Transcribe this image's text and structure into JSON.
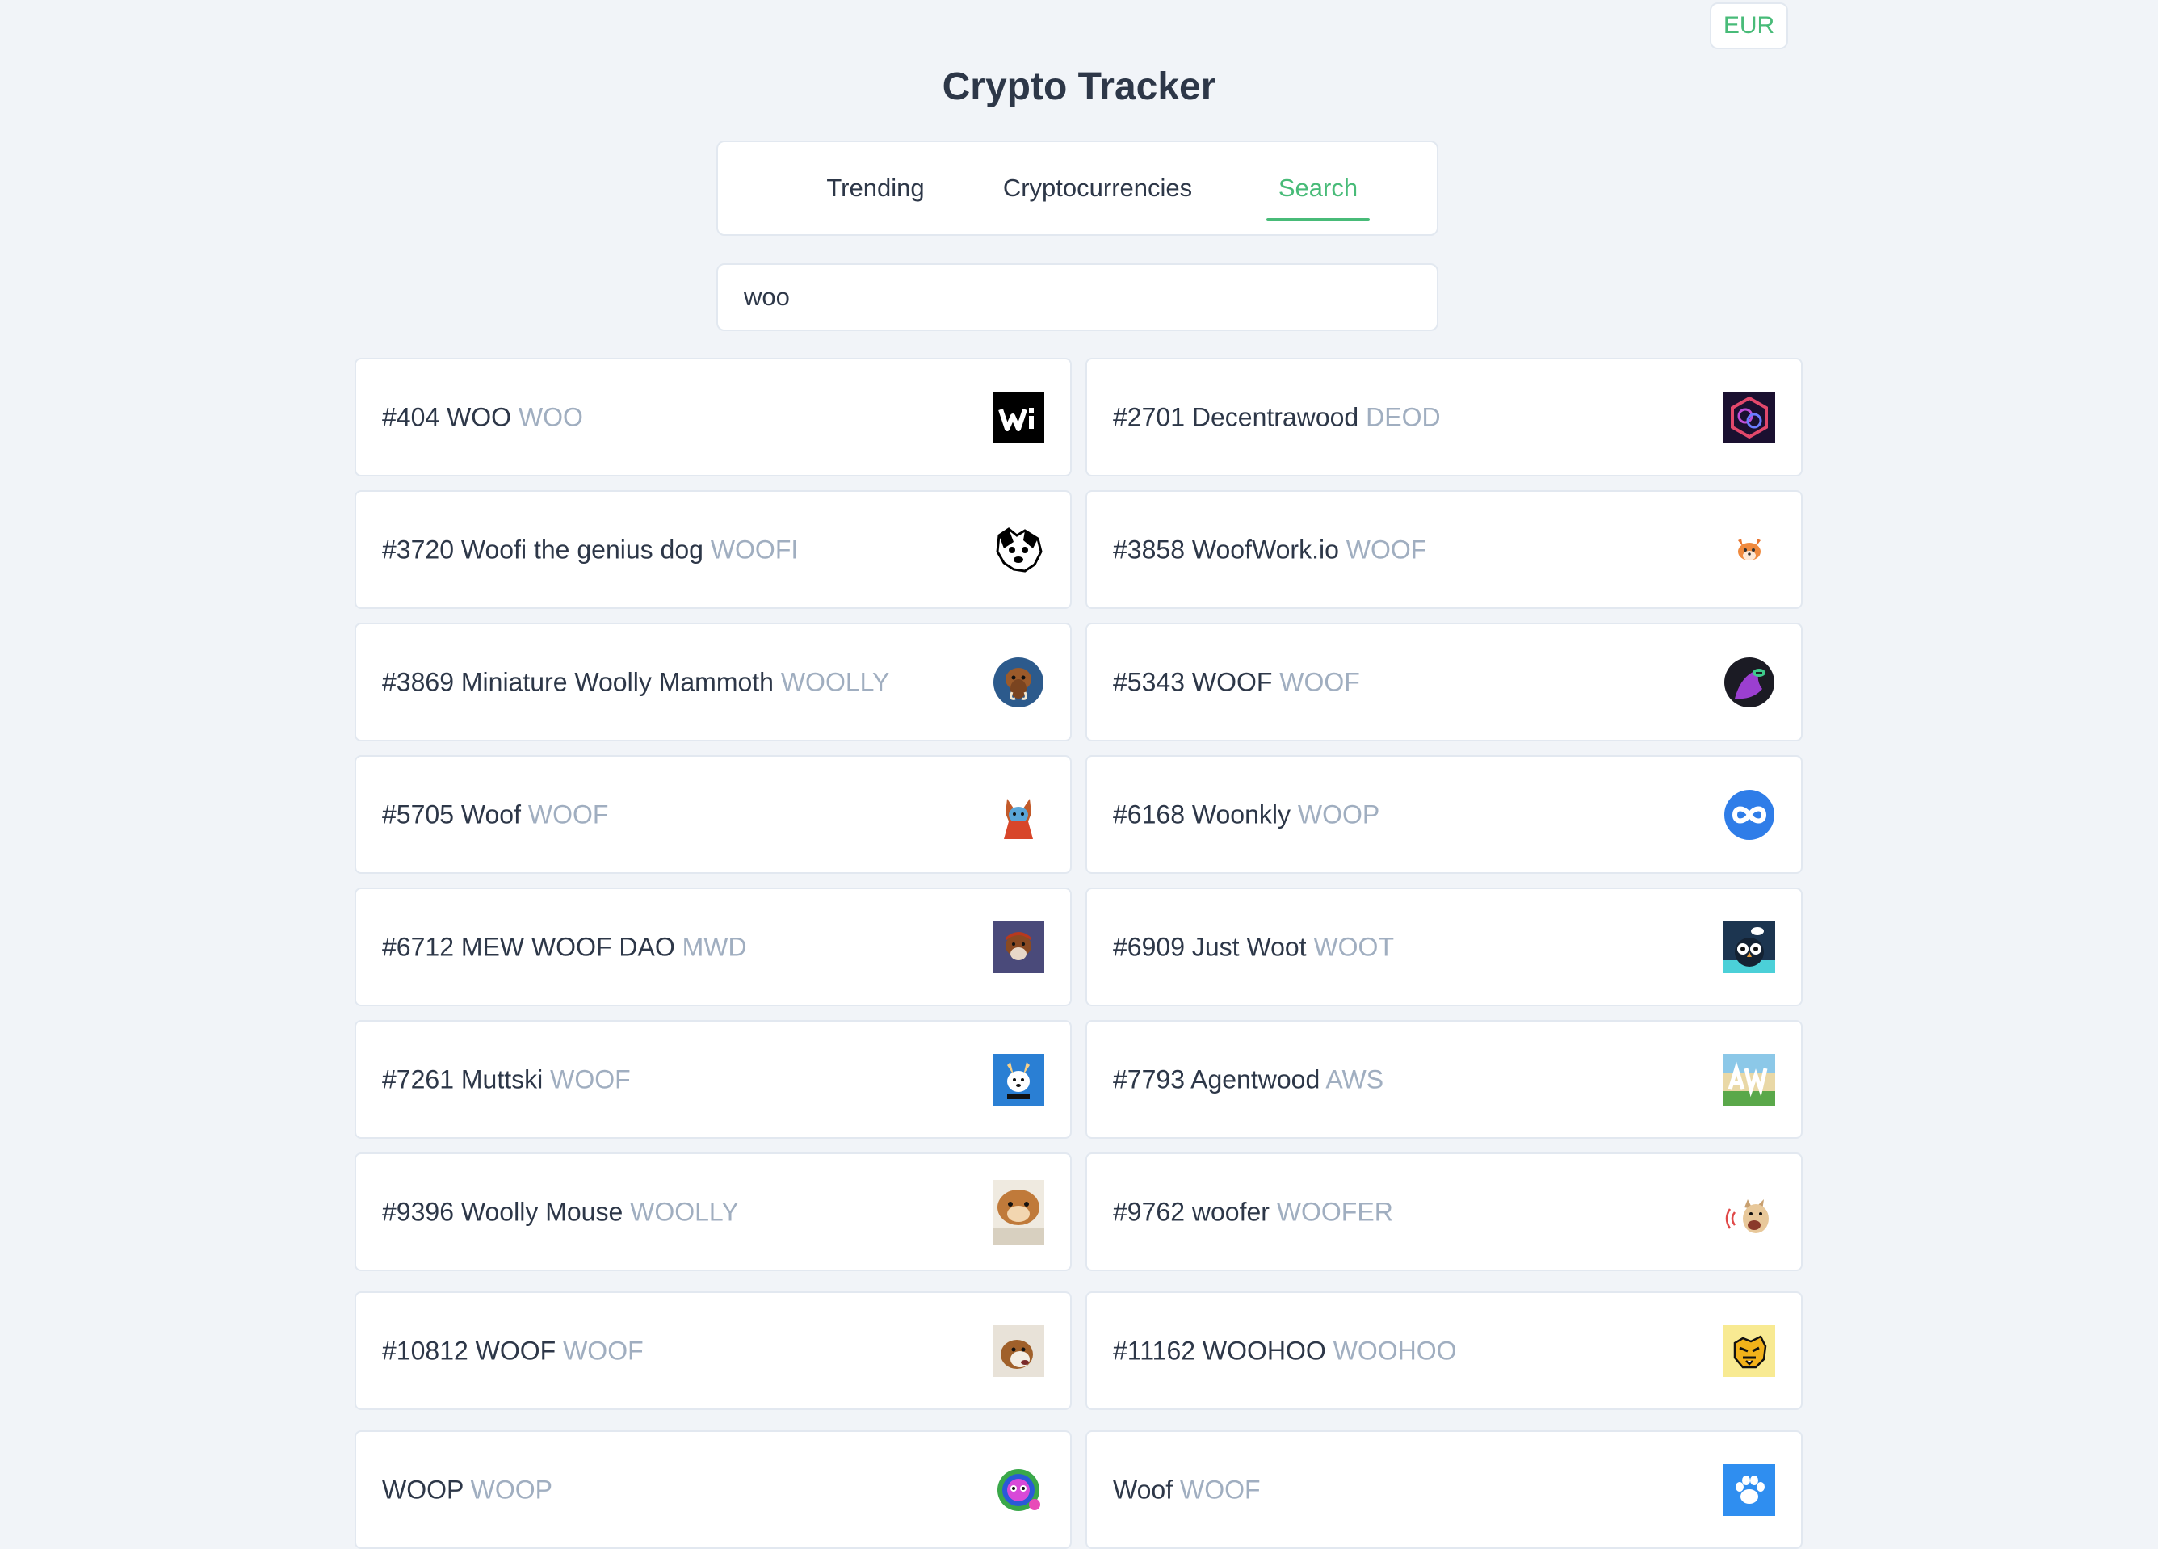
{
  "header": {
    "currency": "EUR",
    "title": "Crypto Tracker"
  },
  "tabs": [
    {
      "label": "Trending",
      "active": false
    },
    {
      "label": "Cryptocurrencies",
      "active": false
    },
    {
      "label": "Search",
      "active": true
    }
  ],
  "search": {
    "value": "woo",
    "placeholder": ""
  },
  "colors": {
    "accent": "#48bb78",
    "background": "#f1f4f8",
    "text": "#2d3748",
    "muted": "#a0aec0"
  },
  "results": [
    {
      "name": "#404 WOO",
      "symbol": "WOO",
      "icon": "woo-icon"
    },
    {
      "name": "#2701 Decentrawood",
      "symbol": "DEOD",
      "icon": "decentrawood-icon"
    },
    {
      "name": "#3720 Woofi the genius dog",
      "symbol": "WOOFI",
      "icon": "dog-sketch-icon"
    },
    {
      "name": "#3858 WoofWork.io",
      "symbol": "WOOF",
      "icon": "shiba-icon"
    },
    {
      "name": "#3869 Miniature Woolly Mammoth",
      "symbol": "WOOLLY",
      "icon": "mammoth-icon"
    },
    {
      "name": "#5343 WOOF",
      "symbol": "WOOF",
      "icon": "purple-wolf-icon"
    },
    {
      "name": "#5705 Woof",
      "symbol": "WOOF",
      "icon": "dog-astronaut-icon"
    },
    {
      "name": "#6168 Woonkly",
      "symbol": "WOOP",
      "icon": "infinity-icon"
    },
    {
      "name": "#6712 MEW WOOF DAO",
      "symbol": "MWD",
      "icon": "monkey-icon"
    },
    {
      "name": "#6909 Just Woot",
      "symbol": "WOOT",
      "icon": "owl-icon"
    },
    {
      "name": "#7261 Muttski",
      "symbol": "WOOF",
      "icon": "husky-icon"
    },
    {
      "name": "#7793 Agentwood",
      "symbol": "AWS",
      "icon": "aw-logo-icon"
    },
    {
      "name": "#9396 Woolly Mouse",
      "symbol": "WOOLLY",
      "icon": "hamster-icon"
    },
    {
      "name": "#9762 woofer",
      "symbol": "WOOFER",
      "icon": "barking-dog-icon"
    },
    {
      "name": "#10812 WOOF",
      "symbol": "WOOF",
      "icon": "dog-photo-icon"
    },
    {
      "name": "#11162 WOOHOO",
      "symbol": "WOOHOO",
      "icon": "tiger-icon"
    },
    {
      "name": "WOOP",
      "symbol": "WOOP",
      "icon": "colorful-mask-icon"
    },
    {
      "name": "Woof",
      "symbol": "WOOF",
      "icon": "paw-icon"
    }
  ]
}
